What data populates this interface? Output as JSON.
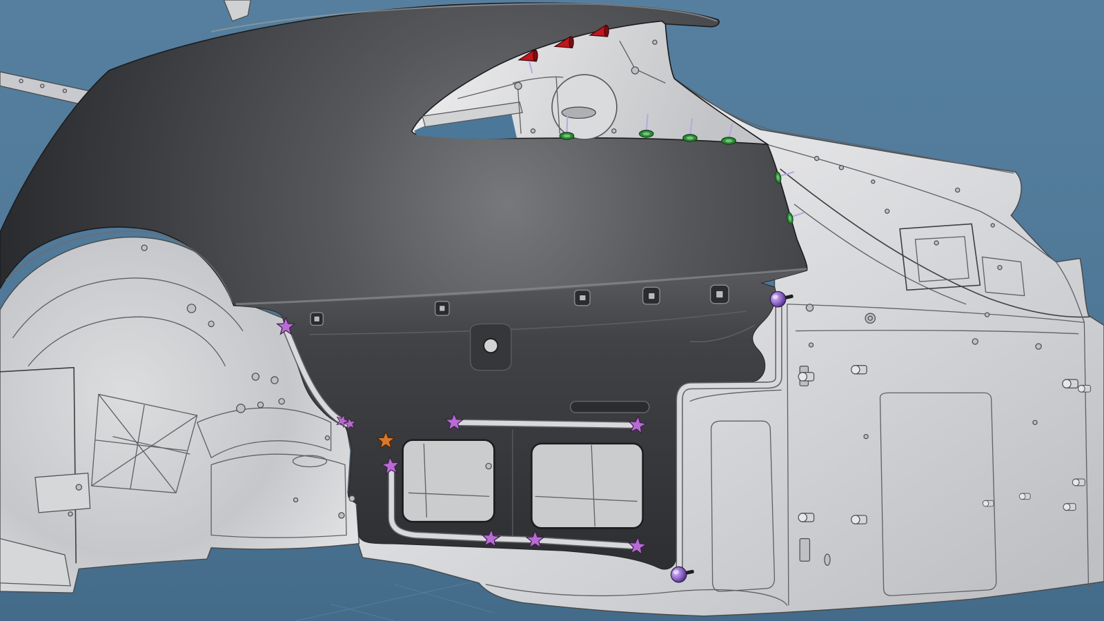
{
  "colors": {
    "background": "#4b7799",
    "panel": "#2b2c2f",
    "structure": "#d6d7d9",
    "tape": "#d9d9db",
    "star_marker": "#b86bd3",
    "star_marker_alt": "#d9782a",
    "cone_marker": "#c2161e",
    "ring_marker": "#2e8b35",
    "pin_marker": "#8e63c9"
  },
  "icons": [
    "star-marker-icon",
    "cone-marker-icon",
    "ring-marker-icon",
    "pin-marker-icon"
  ]
}
